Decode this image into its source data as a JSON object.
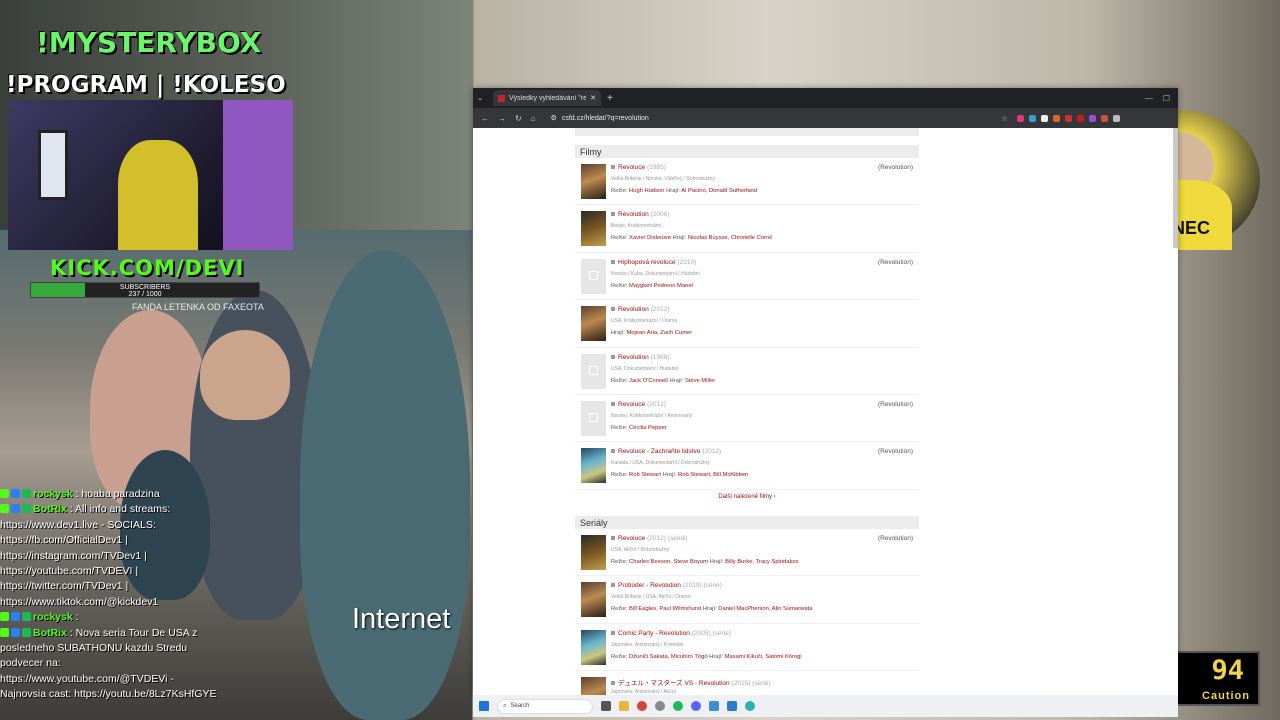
{
  "stream": {
    "mysterybox": "!MYSTERYBOX",
    "program": "!PROGRAM | !KOLESO",
    "kick": "KICK.COM/DEVI",
    "subs_label": "SUBSCRIBERS",
    "subs_count": "237 / 1000",
    "subs_progress": 0.237,
    "ticker": "FANDA LETENKA OD FAXEOTA",
    "overlay_text": "Internet",
    "caution_value": "94",
    "caution_label": "Caution",
    "right_cam_shirt": "PNEC",
    "chat": [
      {
        "user": "rockysk",
        "text": ": hoaba paradzina"
      },
      {
        "user": "BotRix",
        "text": ": All info and streams:"
      },
      {
        "user": "",
        "text": "https://www.dev1.live - SOCIALS:"
      },
      {
        "user": "",
        "text": "https://fb.com/OfficialDev1 |"
      },
      {
        "user": "",
        "text": "https://instagram.com/TVDev1 |"
      },
      {
        "user": "",
        "text": "https://youtube.com/TVDEVI |"
      },
      {
        "user": "",
        "text": "https://twitter.com/TVDev1 |"
      },
      {
        "user": "",
        "text": "https://www.tiktok.com/@kickdev1"
      },
      {
        "user": "rockysk",
        "text": ":"
      },
      {
        "user": "BotRix",
        "text": ": Nova seria Tour De USA z"
      },
      {
        "user": "",
        "text": "posledneho SUBATHONU kazdu Stredu"
      },
      {
        "user": "",
        "text": "podvecer na:"
      },
      {
        "user": "",
        "text": "https://www.youtube.com/@TVDEVi -"
      },
      {
        "user": "",
        "text": "Najnovsia cast: https://youtu.be/8Lz7KsHfGYE"
      }
    ]
  },
  "browser": {
    "tab_title": "Výsledky vyhledávání \"revolut...",
    "url": "csfd.cz/hledat/?q=revolution",
    "taskbar_search": "Search",
    "colors": {
      "accent": "#a60d0d",
      "tabbar": "#202124",
      "toolbar": "#35363a"
    }
  },
  "results": {
    "films_heading": "Filmy",
    "series_heading": "Seriály",
    "more_films": "Další nalezené filmy ›",
    "films": [
      {
        "title": "Revoluce",
        "year": "(1985)",
        "orig": "(Revolution)",
        "meta": "Velká Británie / Norsko, Válečný / Dobrodružný",
        "credits": [
          [
            "Režie:",
            "Hugh Hudson"
          ],
          [
            "Hrají:",
            "Al Pacino, Donald Sutherland"
          ]
        ],
        "thumb": "img"
      },
      {
        "title": "Révolution",
        "year": "(2006)",
        "orig": "",
        "meta": "Belgie, Krátkometrážní",
        "credits": [
          [
            "Režie:",
            "Xavier Diskeuve"
          ],
          [
            "Hrají:",
            "Nicolas Buysse, Christelle Cornil"
          ]
        ],
        "thumb": "img3"
      },
      {
        "title": "Hiphopová revoluce",
        "year": "(2010)",
        "orig": "(Revolution)",
        "meta": "Norsko / Kuba, Dokumentární / Hudební",
        "credits": [
          [
            "Režie:",
            "Maygkell Pedreon Manel"
          ]
        ],
        "thumb": "ph"
      },
      {
        "title": "Revolution",
        "year": "(2012)",
        "orig": "",
        "meta": "USA, Krátkometrážní / Drama",
        "credits": [
          [
            "Hrají:",
            "Mojean Aria, Zach Cumer"
          ]
        ],
        "thumb": "img"
      },
      {
        "title": "Revolution",
        "year": "(1968)",
        "orig": "",
        "meta": "USA, Dokumentární / Hudební",
        "credits": [
          [
            "Režie:",
            "Jack O'Connell"
          ],
          [
            "Hrají:",
            "Steve Miller"
          ]
        ],
        "thumb": "ph"
      },
      {
        "title": "Revoluce",
        "year": "(2012)",
        "orig": "(Revolution)",
        "meta": "Norsko, Krátkometrážní / Animovaný",
        "credits": [
          [
            "Režie:",
            "Cécilia Pepper"
          ]
        ],
        "thumb": "ph"
      },
      {
        "title": "Revoluce - Zachraňte lidstvo",
        "year": "(2012)",
        "orig": "(Revolution)",
        "meta": "Kanada / USA, Dokumentární / Dobrodružný",
        "credits": [
          [
            "Režie:",
            "Rob Stewart"
          ],
          [
            "Hrají:",
            "Rob Stewart, Bill McKibben"
          ]
        ],
        "thumb": "img2"
      }
    ],
    "series": [
      {
        "title": "Revoluce",
        "year": "(2012) (seriál)",
        "orig": "(Revolution)",
        "meta": "USA, Akční / Dobrodružný",
        "credits": [
          [
            "Režie:",
            "Charles Beeson, Steve Boyum"
          ],
          [
            "Hrají:",
            "Billy Burke, Tracy Spiridakos"
          ]
        ],
        "thumb": "img3"
      },
      {
        "title": "Protiúder - Revolution",
        "year": "(2019) (série)",
        "orig": "",
        "meta": "Velká Británie / USA, Akční / Drama",
        "credits": [
          [
            "Režie:",
            "Bill Eagles, Paul Wilmshurst"
          ],
          [
            "Hrají:",
            "Daniel MacPherson, Alin Sumarwata"
          ]
        ],
        "thumb": "img"
      },
      {
        "title": "Comic Party - Revolution",
        "year": "(2005) (série)",
        "orig": "",
        "meta": "Japonsko, Animovaný / Komedie",
        "credits": [
          [
            "Režie:",
            "Džuniči Sakata, Micuhiro Tógó"
          ],
          [
            "Hrají:",
            "Masami Kikuči, Satomi Kórogi"
          ]
        ],
        "thumb": "img2"
      },
      {
        "title": "デュエル・マスターズ VS - Revolution",
        "year": "(2015) (série)",
        "orig": "",
        "meta": "Japonsko, Animovaný / Akční",
        "credits": [],
        "thumb": "img"
      }
    ]
  }
}
